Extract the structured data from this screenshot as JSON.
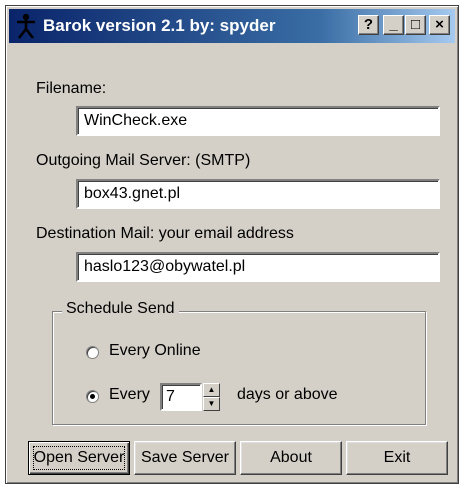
{
  "window": {
    "title": "Barok version 2.1 by: spyder",
    "controls": {
      "help": "?",
      "minimize": "_",
      "maximize": "□",
      "close": "×"
    }
  },
  "form": {
    "filename": {
      "label": "Filename:",
      "value": "WinCheck.exe"
    },
    "smtp": {
      "label": "Outgoing Mail Server: (SMTP)",
      "value": "box43.gnet.pl"
    },
    "destination": {
      "label": "Destination Mail: your email address",
      "value": "haslo123@obywatel.pl"
    }
  },
  "schedule": {
    "legend": "Schedule Send",
    "every_online_label": "Every Online",
    "every_label": "Every",
    "days_value": "7",
    "days_suffix": "days or above",
    "selected": "every_days"
  },
  "buttons": {
    "open_server": "Open Server",
    "save_server": "Save Server",
    "about": "About",
    "exit": "Exit"
  },
  "icons": {
    "app": "stick-figure-icon",
    "spin_up": "up-arrow-icon",
    "spin_down": "down-arrow-icon"
  }
}
